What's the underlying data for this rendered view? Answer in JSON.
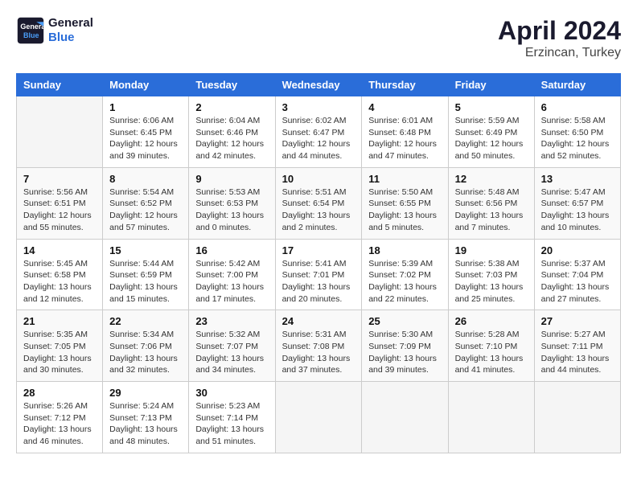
{
  "header": {
    "logo_line1": "General",
    "logo_line2": "Blue",
    "month_year": "April 2024",
    "location": "Erzincan, Turkey"
  },
  "days_of_week": [
    "Sunday",
    "Monday",
    "Tuesday",
    "Wednesday",
    "Thursday",
    "Friday",
    "Saturday"
  ],
  "weeks": [
    [
      {
        "day": "",
        "info": ""
      },
      {
        "day": "1",
        "info": "Sunrise: 6:06 AM\nSunset: 6:45 PM\nDaylight: 12 hours\nand 39 minutes."
      },
      {
        "day": "2",
        "info": "Sunrise: 6:04 AM\nSunset: 6:46 PM\nDaylight: 12 hours\nand 42 minutes."
      },
      {
        "day": "3",
        "info": "Sunrise: 6:02 AM\nSunset: 6:47 PM\nDaylight: 12 hours\nand 44 minutes."
      },
      {
        "day": "4",
        "info": "Sunrise: 6:01 AM\nSunset: 6:48 PM\nDaylight: 12 hours\nand 47 minutes."
      },
      {
        "day": "5",
        "info": "Sunrise: 5:59 AM\nSunset: 6:49 PM\nDaylight: 12 hours\nand 50 minutes."
      },
      {
        "day": "6",
        "info": "Sunrise: 5:58 AM\nSunset: 6:50 PM\nDaylight: 12 hours\nand 52 minutes."
      }
    ],
    [
      {
        "day": "7",
        "info": "Sunrise: 5:56 AM\nSunset: 6:51 PM\nDaylight: 12 hours\nand 55 minutes."
      },
      {
        "day": "8",
        "info": "Sunrise: 5:54 AM\nSunset: 6:52 PM\nDaylight: 12 hours\nand 57 minutes."
      },
      {
        "day": "9",
        "info": "Sunrise: 5:53 AM\nSunset: 6:53 PM\nDaylight: 13 hours\nand 0 minutes."
      },
      {
        "day": "10",
        "info": "Sunrise: 5:51 AM\nSunset: 6:54 PM\nDaylight: 13 hours\nand 2 minutes."
      },
      {
        "day": "11",
        "info": "Sunrise: 5:50 AM\nSunset: 6:55 PM\nDaylight: 13 hours\nand 5 minutes."
      },
      {
        "day": "12",
        "info": "Sunrise: 5:48 AM\nSunset: 6:56 PM\nDaylight: 13 hours\nand 7 minutes."
      },
      {
        "day": "13",
        "info": "Sunrise: 5:47 AM\nSunset: 6:57 PM\nDaylight: 13 hours\nand 10 minutes."
      }
    ],
    [
      {
        "day": "14",
        "info": "Sunrise: 5:45 AM\nSunset: 6:58 PM\nDaylight: 13 hours\nand 12 minutes."
      },
      {
        "day": "15",
        "info": "Sunrise: 5:44 AM\nSunset: 6:59 PM\nDaylight: 13 hours\nand 15 minutes."
      },
      {
        "day": "16",
        "info": "Sunrise: 5:42 AM\nSunset: 7:00 PM\nDaylight: 13 hours\nand 17 minutes."
      },
      {
        "day": "17",
        "info": "Sunrise: 5:41 AM\nSunset: 7:01 PM\nDaylight: 13 hours\nand 20 minutes."
      },
      {
        "day": "18",
        "info": "Sunrise: 5:39 AM\nSunset: 7:02 PM\nDaylight: 13 hours\nand 22 minutes."
      },
      {
        "day": "19",
        "info": "Sunrise: 5:38 AM\nSunset: 7:03 PM\nDaylight: 13 hours\nand 25 minutes."
      },
      {
        "day": "20",
        "info": "Sunrise: 5:37 AM\nSunset: 7:04 PM\nDaylight: 13 hours\nand 27 minutes."
      }
    ],
    [
      {
        "day": "21",
        "info": "Sunrise: 5:35 AM\nSunset: 7:05 PM\nDaylight: 13 hours\nand 30 minutes."
      },
      {
        "day": "22",
        "info": "Sunrise: 5:34 AM\nSunset: 7:06 PM\nDaylight: 13 hours\nand 32 minutes."
      },
      {
        "day": "23",
        "info": "Sunrise: 5:32 AM\nSunset: 7:07 PM\nDaylight: 13 hours\nand 34 minutes."
      },
      {
        "day": "24",
        "info": "Sunrise: 5:31 AM\nSunset: 7:08 PM\nDaylight: 13 hours\nand 37 minutes."
      },
      {
        "day": "25",
        "info": "Sunrise: 5:30 AM\nSunset: 7:09 PM\nDaylight: 13 hours\nand 39 minutes."
      },
      {
        "day": "26",
        "info": "Sunrise: 5:28 AM\nSunset: 7:10 PM\nDaylight: 13 hours\nand 41 minutes."
      },
      {
        "day": "27",
        "info": "Sunrise: 5:27 AM\nSunset: 7:11 PM\nDaylight: 13 hours\nand 44 minutes."
      }
    ],
    [
      {
        "day": "28",
        "info": "Sunrise: 5:26 AM\nSunset: 7:12 PM\nDaylight: 13 hours\nand 46 minutes."
      },
      {
        "day": "29",
        "info": "Sunrise: 5:24 AM\nSunset: 7:13 PM\nDaylight: 13 hours\nand 48 minutes."
      },
      {
        "day": "30",
        "info": "Sunrise: 5:23 AM\nSunset: 7:14 PM\nDaylight: 13 hours\nand 51 minutes."
      },
      {
        "day": "",
        "info": ""
      },
      {
        "day": "",
        "info": ""
      },
      {
        "day": "",
        "info": ""
      },
      {
        "day": "",
        "info": ""
      }
    ]
  ]
}
